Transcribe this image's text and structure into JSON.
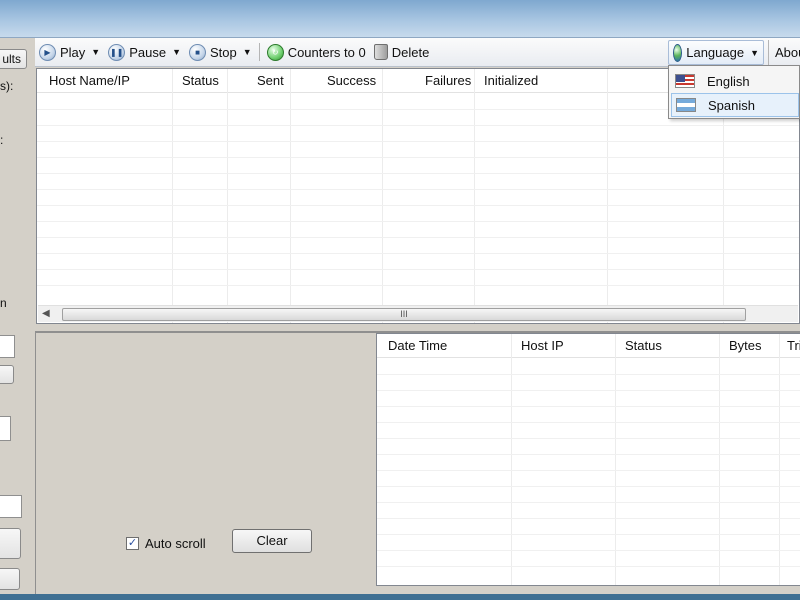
{
  "left_panel": {
    "results_button": "ults",
    "label_seconds": "s):",
    "label_colon": ":",
    "label_n": "n"
  },
  "toolbar": {
    "play": "Play",
    "pause": "Pause",
    "stop": "Stop",
    "counters": "Counters to 0",
    "delete": "Delete",
    "language": "Language",
    "about": "Abou"
  },
  "language_menu": {
    "items": [
      "English",
      "Spanish"
    ],
    "selected": "Spanish"
  },
  "hosts_table": {
    "columns": [
      "Host Name/IP",
      "Status",
      "Sent",
      "Success",
      "Failures",
      "Initialized"
    ],
    "rows": [],
    "scroll_grip": "III"
  },
  "log_panel": {
    "auto_scroll_label": "Auto scroll",
    "auto_scroll_checked": true,
    "check_mark": "✓",
    "clear_button": "Clear",
    "columns": [
      "Date Time",
      "Host IP",
      "Status",
      "Bytes",
      "Tri"
    ],
    "rows": []
  }
}
